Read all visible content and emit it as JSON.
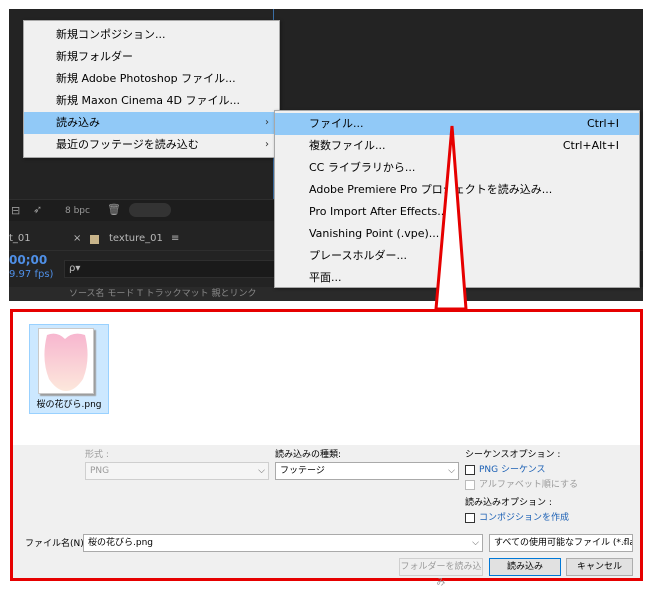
{
  "ae": {
    "bpc": "8 bpc",
    "tab_prev": "t_01",
    "tab_close": "×",
    "tab_texture": "texture_01",
    "tab_menu": "≡",
    "timecode": "00;00",
    "fps": "9.97 fps)",
    "search_glyph": "ρ▾",
    "columns": "ソース名          モード        T  トラックマット   親とリンク"
  },
  "file_menu": {
    "items": [
      {
        "label": "新規コンポジション..."
      },
      {
        "label": "新規フォルダー"
      },
      {
        "label": "新規 Adobe Photoshop ファイル..."
      },
      {
        "label": "新規 Maxon Cinema 4D ファイル..."
      },
      {
        "label": "読み込み",
        "arrow": "›"
      },
      {
        "label": "最近のフッテージを読み込む",
        "arrow": "›"
      }
    ]
  },
  "import_submenu": {
    "items": [
      {
        "label": "ファイル...",
        "shortcut": "Ctrl+I"
      },
      {
        "label": "複数ファイル...",
        "shortcut": "Ctrl+Alt+I"
      },
      {
        "label": "CC ライブラリから..."
      },
      {
        "label": "Adobe Premiere Pro プロジェクトを読み込み..."
      },
      {
        "label": "Pro Import After Effects..."
      },
      {
        "label": "Vanishing Point (.vpe)..."
      },
      {
        "label": "プレースホルダー..."
      },
      {
        "label": "平面..."
      }
    ]
  },
  "callout_color": "#e60000",
  "dialog": {
    "file_item": "桜の花びら.png",
    "format_label": "形式 :",
    "format_value": "PNG",
    "import_as_label": "読み込みの種類:",
    "import_as_value": "フッテージ",
    "sequence_options_label": "シーケンスオプション :",
    "png_sequence": "PNG シーケンス",
    "alpha_order": "アルファベット順にする",
    "import_options_label": "読み込みオプション :",
    "create_composition": "コンポジションを作成",
    "filename_label": "ファイル名(N):",
    "filename_value": "桜の花びら.png",
    "filetype_value": "すべての使用可能なファイル (*.fla;*",
    "dropdown_glyph": "⌵",
    "import_folder_button": "フォルダーを読み込み",
    "import_button": "読み込み",
    "cancel_button": "キャンセル"
  }
}
